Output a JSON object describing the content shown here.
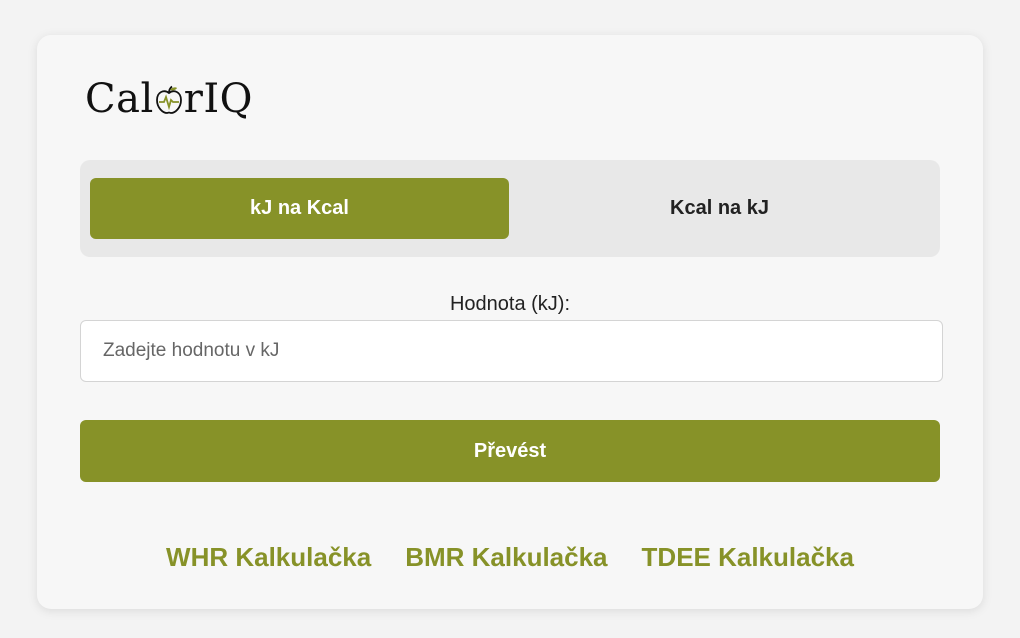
{
  "brand": {
    "logo_prefix": "Cal",
    "logo_icon": "apple-heartbeat-icon",
    "logo_suffix": "rIQ",
    "accent_color": "#879228"
  },
  "toggle": {
    "active_label": "kJ na Kcal",
    "inactive_label": "Kcal na kJ"
  },
  "form": {
    "label": "Hodnota (kJ):",
    "placeholder": "Zadejte hodnotu v kJ",
    "value": "",
    "submit_label": "Převést"
  },
  "links": {
    "whr": "WHR Kalkulačka",
    "bmr": "BMR Kalkulačka",
    "tdee": "TDEE Kalkulačka"
  }
}
